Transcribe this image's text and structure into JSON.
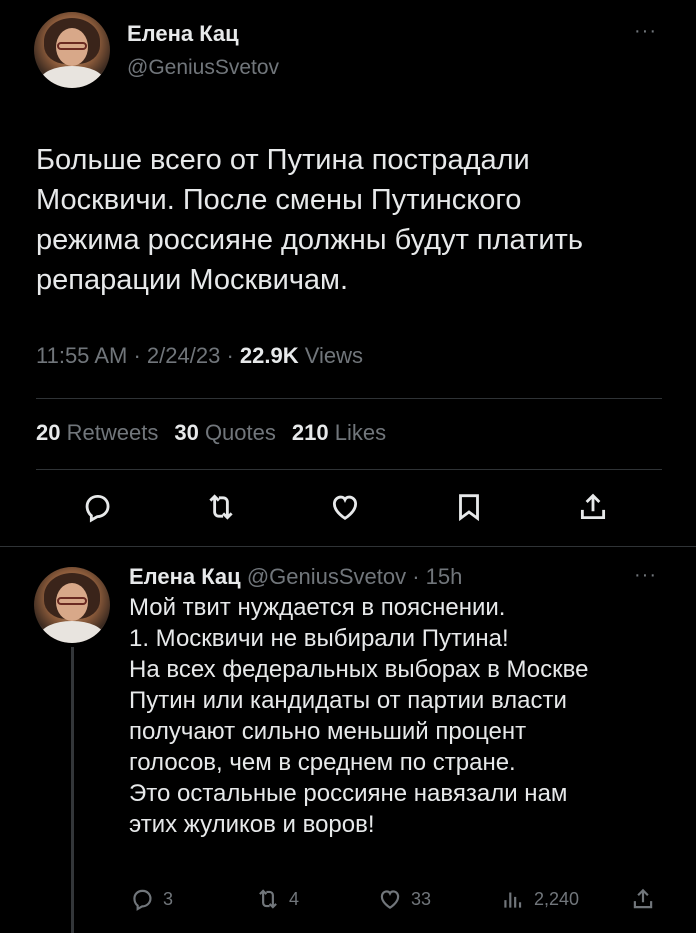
{
  "main_tweet": {
    "author_name": "Елена Кац",
    "author_handle": "@GeniusSvetov",
    "more_label": "···",
    "text": "Больше всего от Путина пострадали\nМосквичи. После смены Путинского\nрежима россияне должны будут платить\nрепарации Москвичам.",
    "time": "11:55 AM",
    "date": "2/24/23",
    "views_count": "22.9K",
    "views_label": "Views",
    "retweets_count": "20",
    "retweets_label": "Retweets",
    "quotes_count": "30",
    "quotes_label": "Quotes",
    "likes_count": "210",
    "likes_label": "Likes",
    "actions": [
      "reply-icon",
      "retweet-icon",
      "like-icon",
      "bookmark-icon",
      "share-icon"
    ]
  },
  "reply_tweet": {
    "author_name": "Елена Кац",
    "author_handle": "@GeniusSvetov",
    "age": "15h",
    "more_label": "···",
    "text": "Мой твит нуждается в пояснении.\n1. Москвичи не выбирали Путина!\nНа всех федеральных выборах в Москве\nПутин или кандидаты от партии власти\nполучают сильно меньший процент\nголосов, чем в среднем по стране.\nЭто остальные россияне навязали нам\nэтих жуликов и воров!",
    "reply_count": "3",
    "retweet_count": "4",
    "like_count": "33",
    "view_count": "2,240"
  },
  "colors": {
    "background": "#000000",
    "text_primary": "#e7e9ea",
    "text_secondary": "#71767b",
    "divider": "#2f3336"
  }
}
